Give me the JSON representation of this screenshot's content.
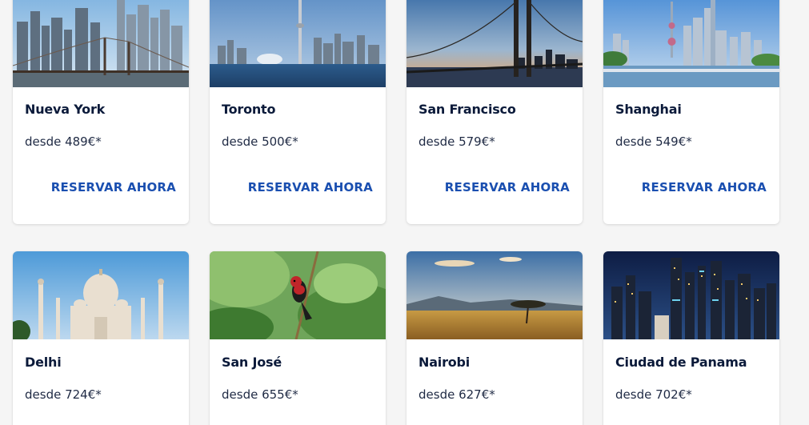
{
  "destinations": [
    {
      "city": "Nueva York",
      "price": "desde 489€*",
      "cta": "RESERVAR AHORA",
      "image": "new-york-skyline-brooklyn-bridge"
    },
    {
      "city": "Toronto",
      "price": "desde 500€*",
      "cta": "RESERVAR AHORA",
      "image": "toronto-skyline-cn-tower"
    },
    {
      "city": "San Francisco",
      "price": "desde 579€*",
      "cta": "RESERVAR AHORA",
      "image": "san-francisco-bay-bridge"
    },
    {
      "city": "Shanghai",
      "price": "desde 549€*",
      "cta": "RESERVAR AHORA",
      "image": "shanghai-pudong-skyline"
    },
    {
      "city": "Delhi",
      "price": "desde 724€*",
      "image": "taj-mahal"
    },
    {
      "city": "San José",
      "price": "desde 655€*",
      "image": "tropical-bird-on-branch"
    },
    {
      "city": "Nairobi",
      "price": "desde 627€*",
      "image": "savanna-acacia-sunset"
    },
    {
      "city": "Ciudad de Panama",
      "price": "desde 702€*",
      "image": "panama-city-night-skyline"
    }
  ],
  "colors": {
    "title": "#0b1a3a",
    "price": "#1f2a44",
    "cta": "#1a4fb0",
    "page_background": "#f5f5f5"
  }
}
